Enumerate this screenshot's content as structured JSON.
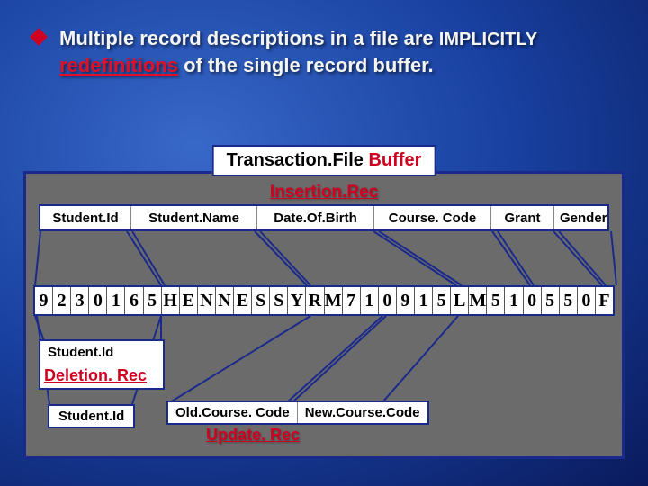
{
  "headline": {
    "prefix": "Multiple record descriptions in a file are ",
    "implicitly": "IMPLICITLY",
    "redef": "redefinitions",
    "suffix": " of the single record buffer."
  },
  "panelTitle": {
    "a": "Transaction.File  ",
    "b": "Buffer"
  },
  "insertion": "Insertion.Rec",
  "cols": [
    "Student.Id",
    "Student.Name",
    "Date.Of.Birth",
    "Course. Code",
    "Grant",
    "Gender"
  ],
  "data": [
    "9",
    "2",
    "3",
    "0",
    "1",
    "6",
    "5",
    "H",
    "E",
    "N",
    "N",
    "E",
    "S",
    "S",
    "Y",
    "R",
    "M",
    "7",
    "1",
    "0",
    "9",
    "1",
    "5",
    "L",
    "M",
    "5",
    "1",
    "0",
    "5",
    "5",
    "0",
    "F"
  ],
  "del": {
    "id": "Student.Id",
    "rec": "Deletion. Rec"
  },
  "upd": {
    "id": "Student.Id",
    "oldc": "Old.Course. Code",
    "newc": "New.Course.Code",
    "rec": "Update. Rec"
  }
}
